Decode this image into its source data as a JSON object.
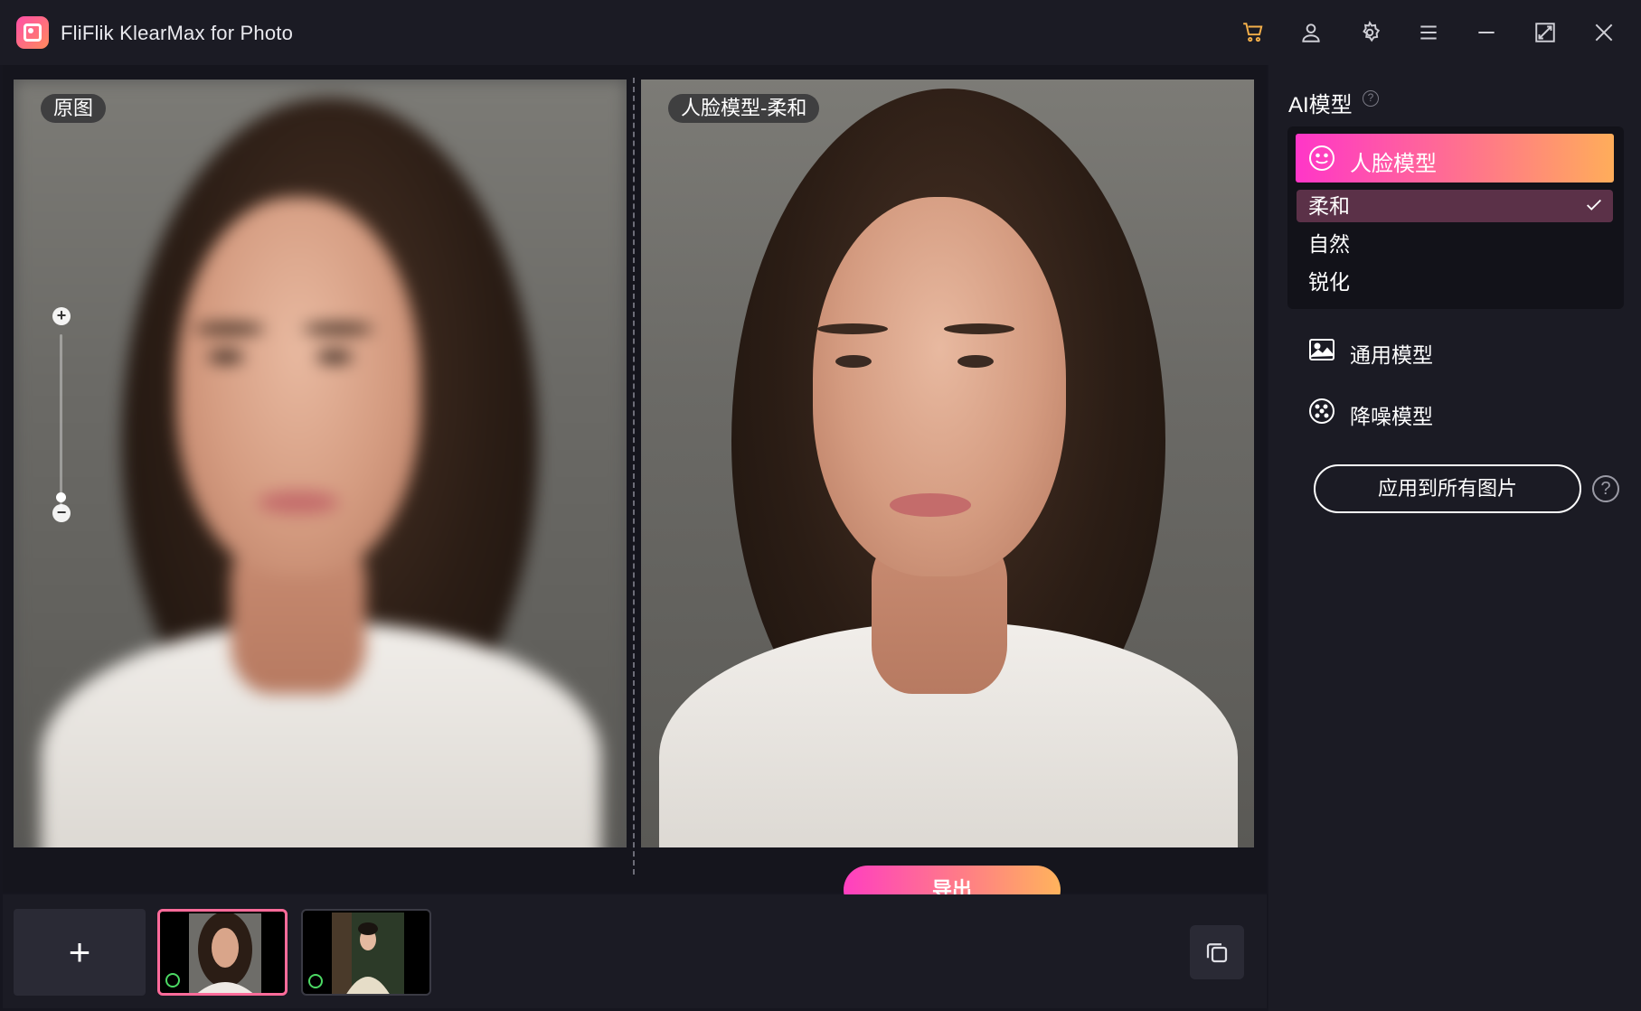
{
  "window": {
    "title": "FliFlik KlearMax for Photo"
  },
  "titlebar_icons": [
    "cart-icon",
    "user-icon",
    "gear-icon",
    "menu-icon",
    "minimize-icon",
    "maximize-icon",
    "close-icon"
  ],
  "colors": {
    "accent_gradient": [
      "#ff36c8",
      "#ffad5a"
    ],
    "cart": "#f5b04a",
    "selected_option_bg": "#5b3148"
  },
  "preview": {
    "left_label": "原图",
    "right_label": "人脸模型-柔和",
    "export_label": "导出",
    "zoom_level": 0.1
  },
  "side": {
    "title": "AI模型",
    "active_model": "人脸模型",
    "sub_options": [
      {
        "label": "柔和",
        "selected": true
      },
      {
        "label": "自然",
        "selected": false
      },
      {
        "label": "锐化",
        "selected": false
      }
    ],
    "other_models": [
      {
        "label": "通用模型",
        "icon": "image-icon"
      },
      {
        "label": "降噪模型",
        "icon": "denoise-icon"
      }
    ],
    "apply_all_label": "应用到所有图片",
    "help_symbol": "?"
  },
  "filmstrip": {
    "add_symbol": "+",
    "thumbnails": [
      {
        "selected": true,
        "processed": true
      },
      {
        "selected": false,
        "processed": true
      }
    ]
  }
}
